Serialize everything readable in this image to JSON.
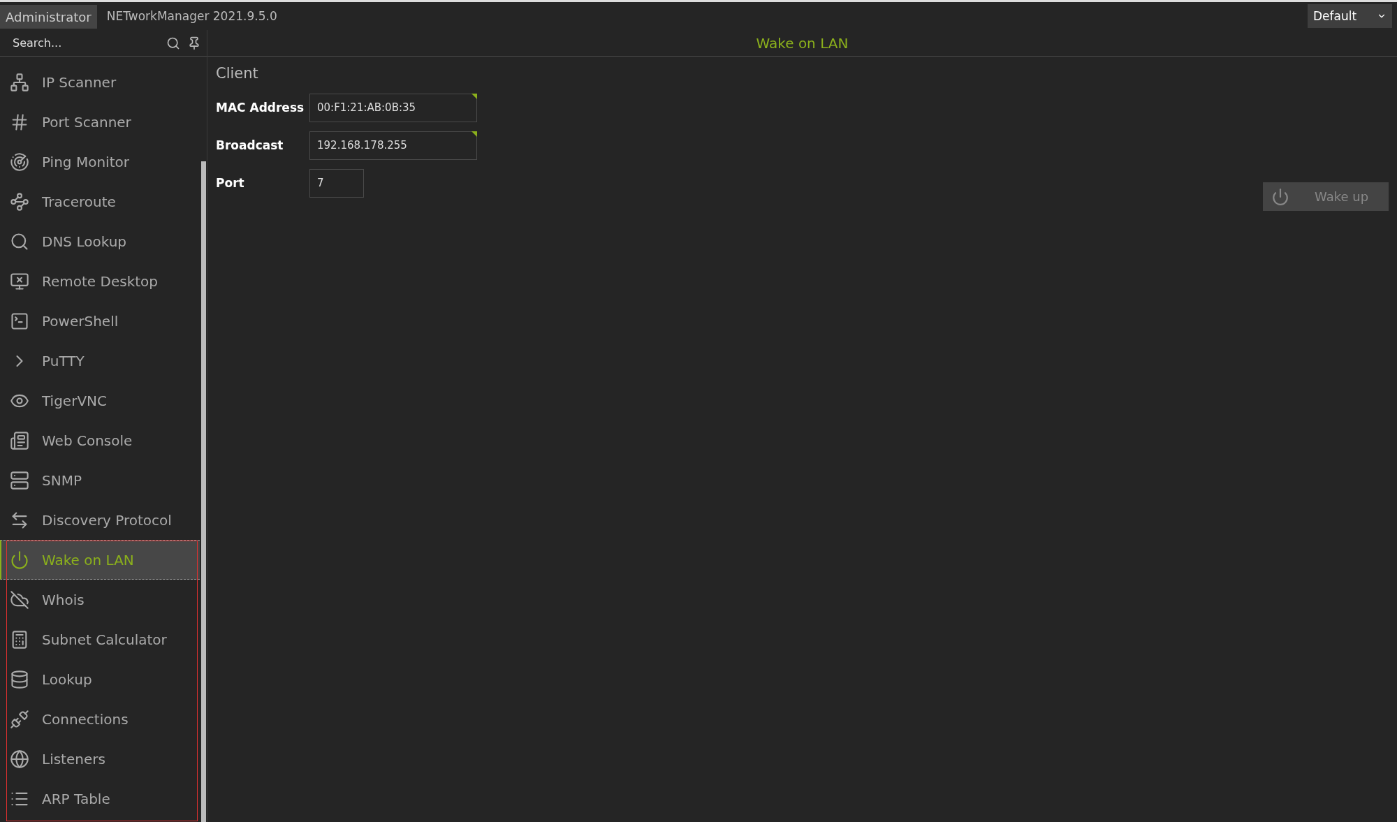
{
  "title_bar": {
    "user_tab": "Administrator",
    "app_title": "NETworkManager 2021.9.5.0",
    "profile_select": "Default"
  },
  "sidebar": {
    "search_placeholder": "Search...",
    "items": [
      {
        "label": "IP Scanner",
        "selected": false
      },
      {
        "label": "Port Scanner",
        "selected": false
      },
      {
        "label": "Ping Monitor",
        "selected": false
      },
      {
        "label": "Traceroute",
        "selected": false
      },
      {
        "label": "DNS Lookup",
        "selected": false
      },
      {
        "label": "Remote Desktop",
        "selected": false
      },
      {
        "label": "PowerShell",
        "selected": false
      },
      {
        "label": "PuTTY",
        "selected": false
      },
      {
        "label": "TigerVNC",
        "selected": false
      },
      {
        "label": "Web Console",
        "selected": false
      },
      {
        "label": "SNMP",
        "selected": false
      },
      {
        "label": "Discovery Protocol",
        "selected": false
      },
      {
        "label": "Wake on LAN",
        "selected": true
      },
      {
        "label": "Whois",
        "selected": false
      },
      {
        "label": "Subnet Calculator",
        "selected": false
      },
      {
        "label": "Lookup",
        "selected": false
      },
      {
        "label": "Connections",
        "selected": false
      },
      {
        "label": "Listeners",
        "selected": false
      },
      {
        "label": "ARP Table",
        "selected": false
      }
    ]
  },
  "page": {
    "title": "Wake on LAN",
    "section": "Client",
    "fields": [
      {
        "label": "MAC Address",
        "value": "00:F1:21:AB:0B:35",
        "marked": true,
        "kind": "wide"
      },
      {
        "label": "Broadcast",
        "value": "192.168.178.255",
        "marked": true,
        "kind": "wide"
      },
      {
        "label": "Port",
        "value": "7",
        "marked": false,
        "kind": "narrow"
      }
    ],
    "wake_button": {
      "label": "Wake up",
      "disabled": true
    }
  }
}
